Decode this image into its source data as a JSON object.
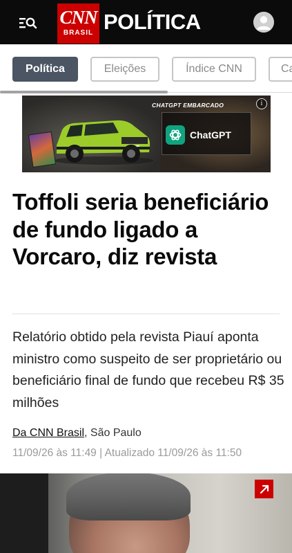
{
  "header": {
    "logo_main": "CNN",
    "logo_sub": "BRASIL",
    "section_title": "POLÍTICA"
  },
  "tabs": [
    {
      "label": "Política",
      "active": true
    },
    {
      "label": "Eleições",
      "active": false
    },
    {
      "label": "Índice CNN",
      "active": false
    },
    {
      "label": "Ca",
      "active": false
    }
  ],
  "ad": {
    "tag": "CHATGPT EMBARCADO",
    "cta_label": "ChatGPT",
    "info_label": "i"
  },
  "article": {
    "headline": "Toffoli seria beneficiário de fundo ligado a Vorcaro, diz revista",
    "summary": "Relatório obtido pela revista Piauí aponta ministro como suspeito de ser proprietário ou beneficiário final de fundo que recebeu R$ 35 milhões",
    "byline_source": "Da CNN Brasil",
    "byline_location": ", São Paulo",
    "dateline": "11/09/26 às 11:49 | Atualizado 11/09/26 às 11:50"
  },
  "colors": {
    "brand_red": "#cc0000",
    "header_bg": "#0b0b0b",
    "active_tab_bg": "#4b5563",
    "chatgpt_green": "#10a37f"
  }
}
